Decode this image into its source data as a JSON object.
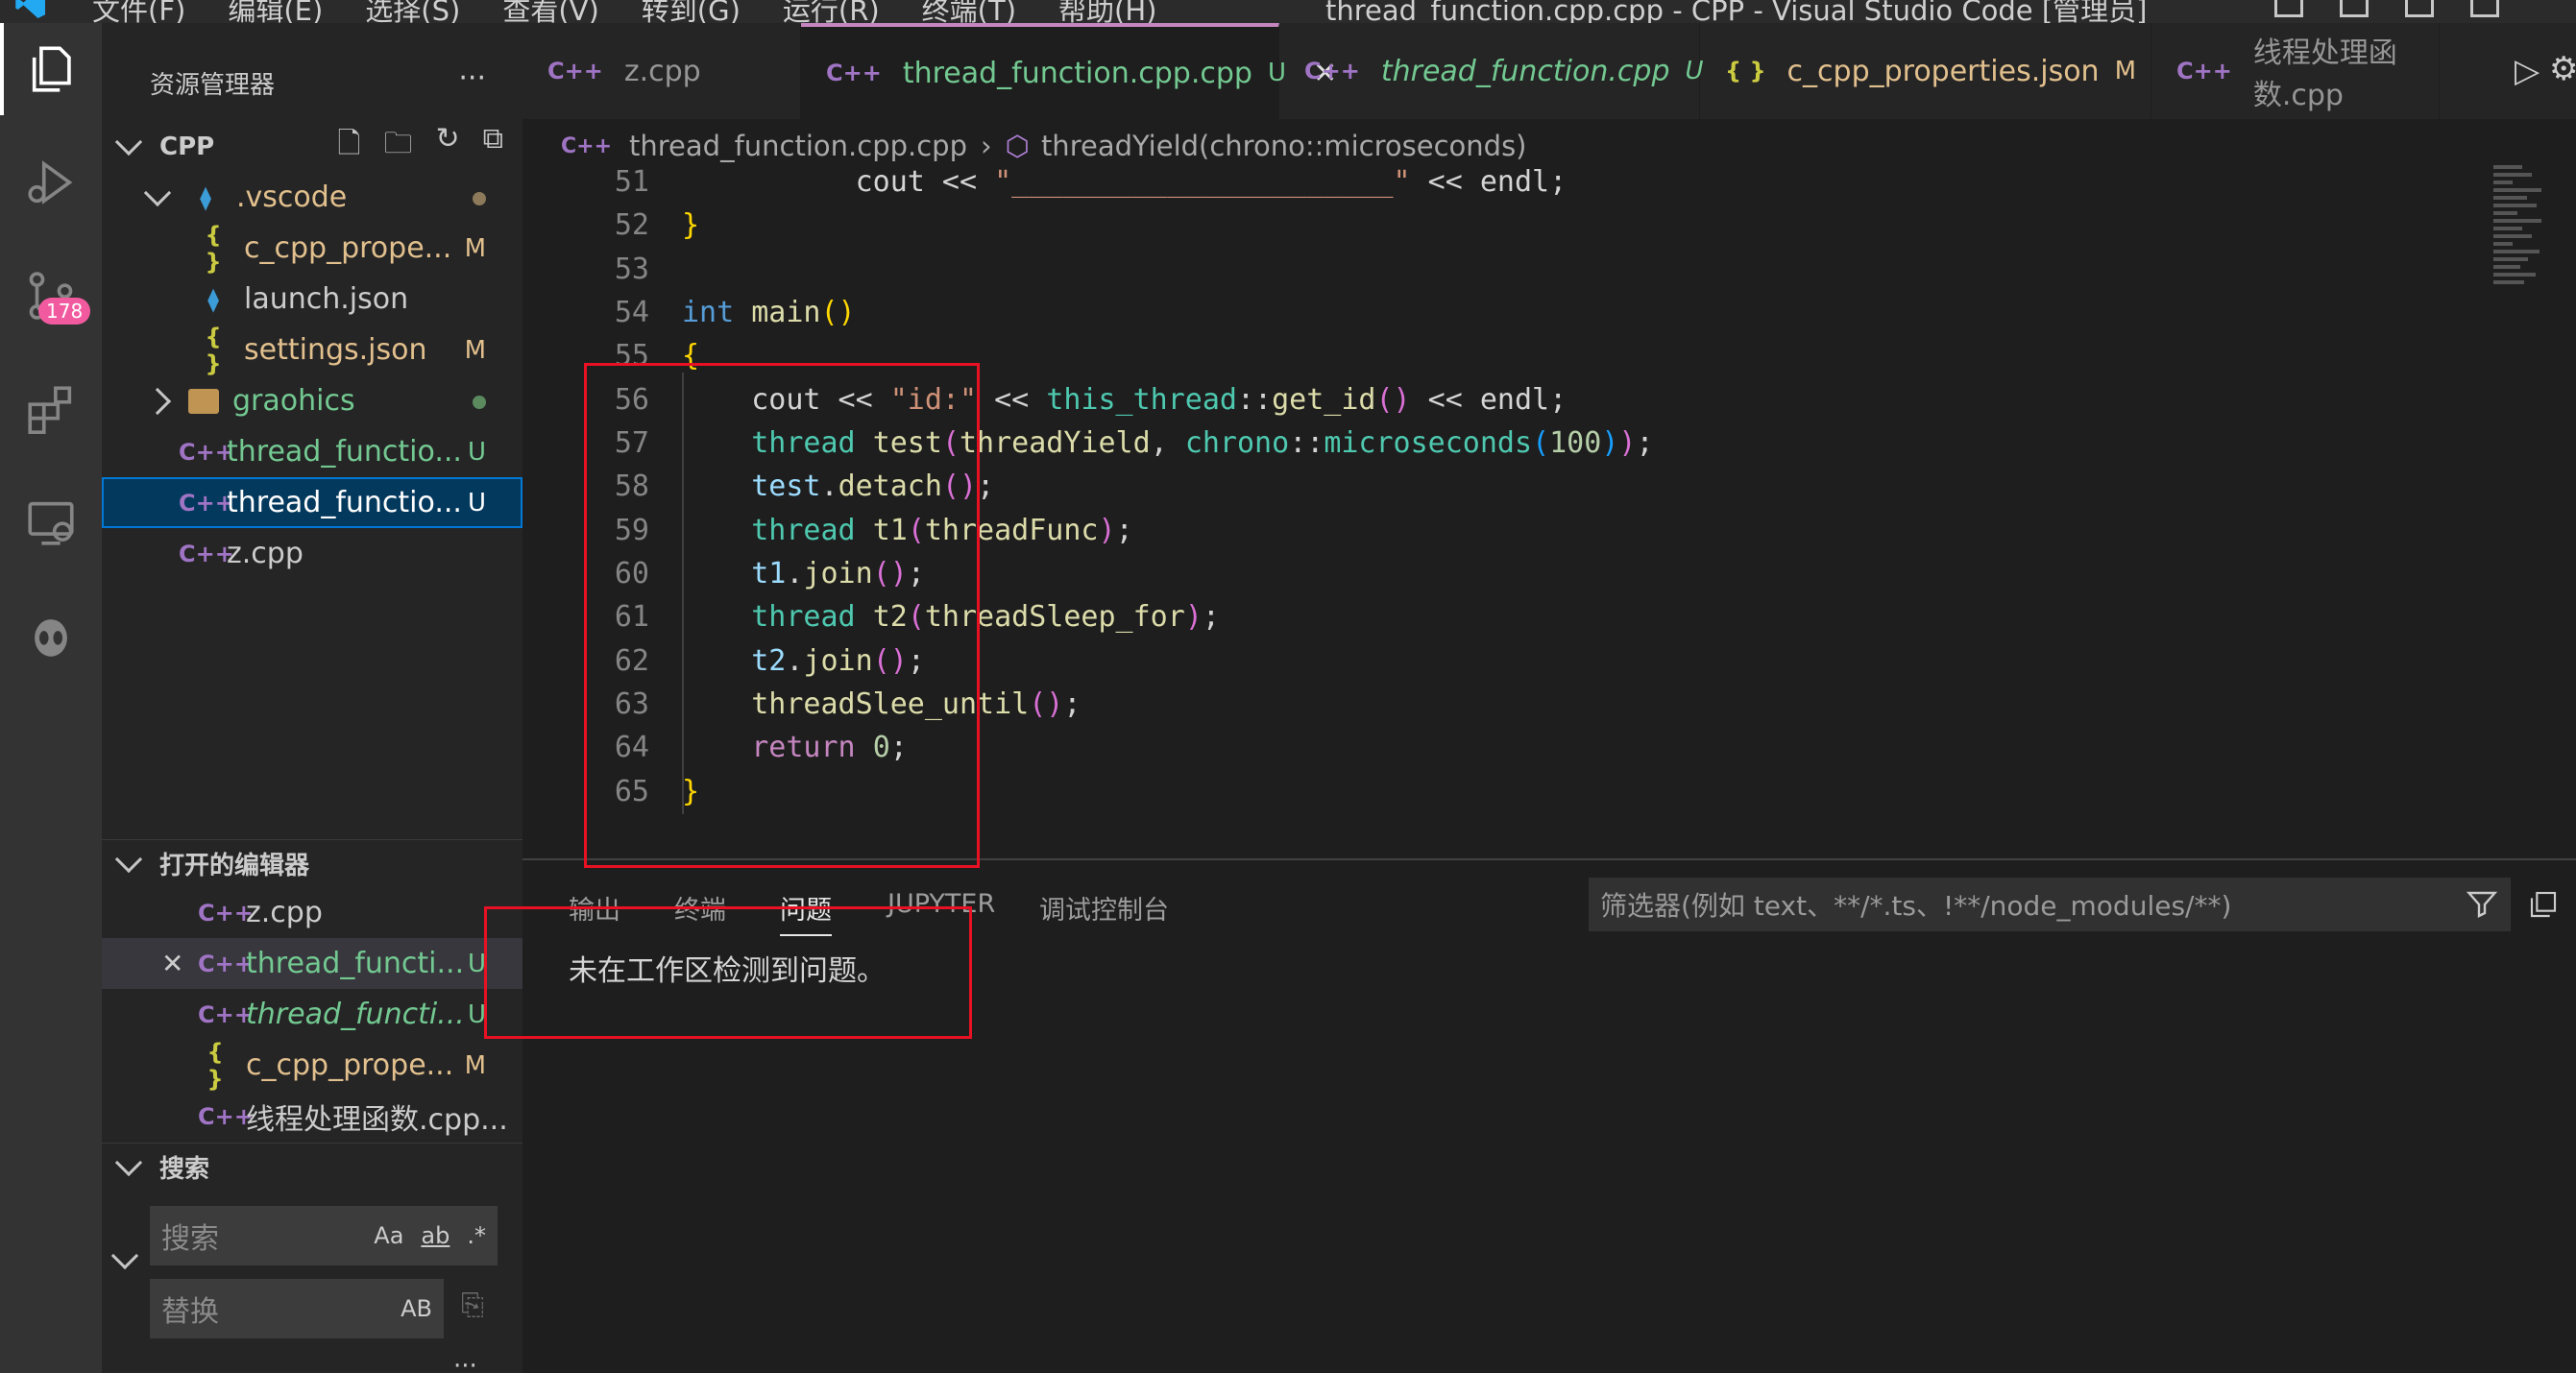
{
  "titlebar": {
    "menu": [
      "文件(F)",
      "编辑(E)",
      "选择(S)",
      "查看(V)",
      "转到(G)",
      "运行(R)",
      "终端(T)",
      "帮助(H)"
    ],
    "title": "thread_function.cpp.cpp - CPP - Visual Studio Code [管理员]"
  },
  "activitybar": {
    "items": [
      "explorer-icon",
      "run-debug-icon",
      "source-control-icon",
      "extensions-icon",
      "remote-explorer-icon",
      "alien-icon"
    ],
    "scm_badge": "178"
  },
  "sidebar": {
    "title": "资源管理器",
    "more": "···",
    "folder_name": "CPP",
    "tree": [
      {
        "label": ".vscode",
        "status": ""
      },
      {
        "label": "c_cpp_prope...",
        "status": "M"
      },
      {
        "label": "launch.json",
        "status": ""
      },
      {
        "label": "settings.json",
        "status": "M"
      },
      {
        "label": "graohics",
        "status": ""
      },
      {
        "label": "thread_functio...",
        "status": "U"
      },
      {
        "label": "thread_functio...",
        "status": "U"
      },
      {
        "label": "z.cpp",
        "status": ""
      }
    ],
    "open_editors_title": "打开的编辑器",
    "open_editors": [
      {
        "label": "z.cpp",
        "status": ""
      },
      {
        "label": "thread_functi...",
        "status": "U"
      },
      {
        "label": "thread_functi...",
        "status": "U"
      },
      {
        "label": "c_cpp_prope...",
        "status": "M"
      },
      {
        "label": "线程处理函数.cpp...",
        "status": ""
      }
    ],
    "search_title": "搜索",
    "search_placeholder": "搜索",
    "replace_placeholder": "替换",
    "search_opts": [
      "Aa",
      "ab",
      ".*"
    ],
    "replace_opt": "AB",
    "more_bottom": "···"
  },
  "tabs": [
    {
      "label": "z.cpp",
      "status": ""
    },
    {
      "label": "thread_function.cpp.cpp",
      "status": "U"
    },
    {
      "label": "thread_function.cpp",
      "status": "U"
    },
    {
      "label": "c_cpp_properties.json",
      "status": "M"
    },
    {
      "label": "线程处理函数.cpp",
      "status": ""
    }
  ],
  "close_glyph": "✕",
  "breadcrumb": {
    "file": "thread_function.cpp.cpp",
    "symbol": "threadYield(chrono::microseconds)"
  },
  "editor": {
    "line_numbers": [
      "51",
      "52",
      "53",
      "54",
      "55",
      "56",
      "57",
      "58",
      "59",
      "60",
      "61",
      "62",
      "63",
      "64",
      "65"
    ]
  },
  "panel": {
    "tabs": [
      "输出",
      "终端",
      "问题",
      "JUPYTER",
      "调试控制台"
    ],
    "filter_placeholder": "筛选器(例如 text、**/*.ts、!**/node_modules/**)",
    "message": "未在工作区检测到问题。"
  },
  "colors": {
    "accent": "#0078d4",
    "highlight_box": "#e81123",
    "active_tab_border": "#c586c0"
  }
}
